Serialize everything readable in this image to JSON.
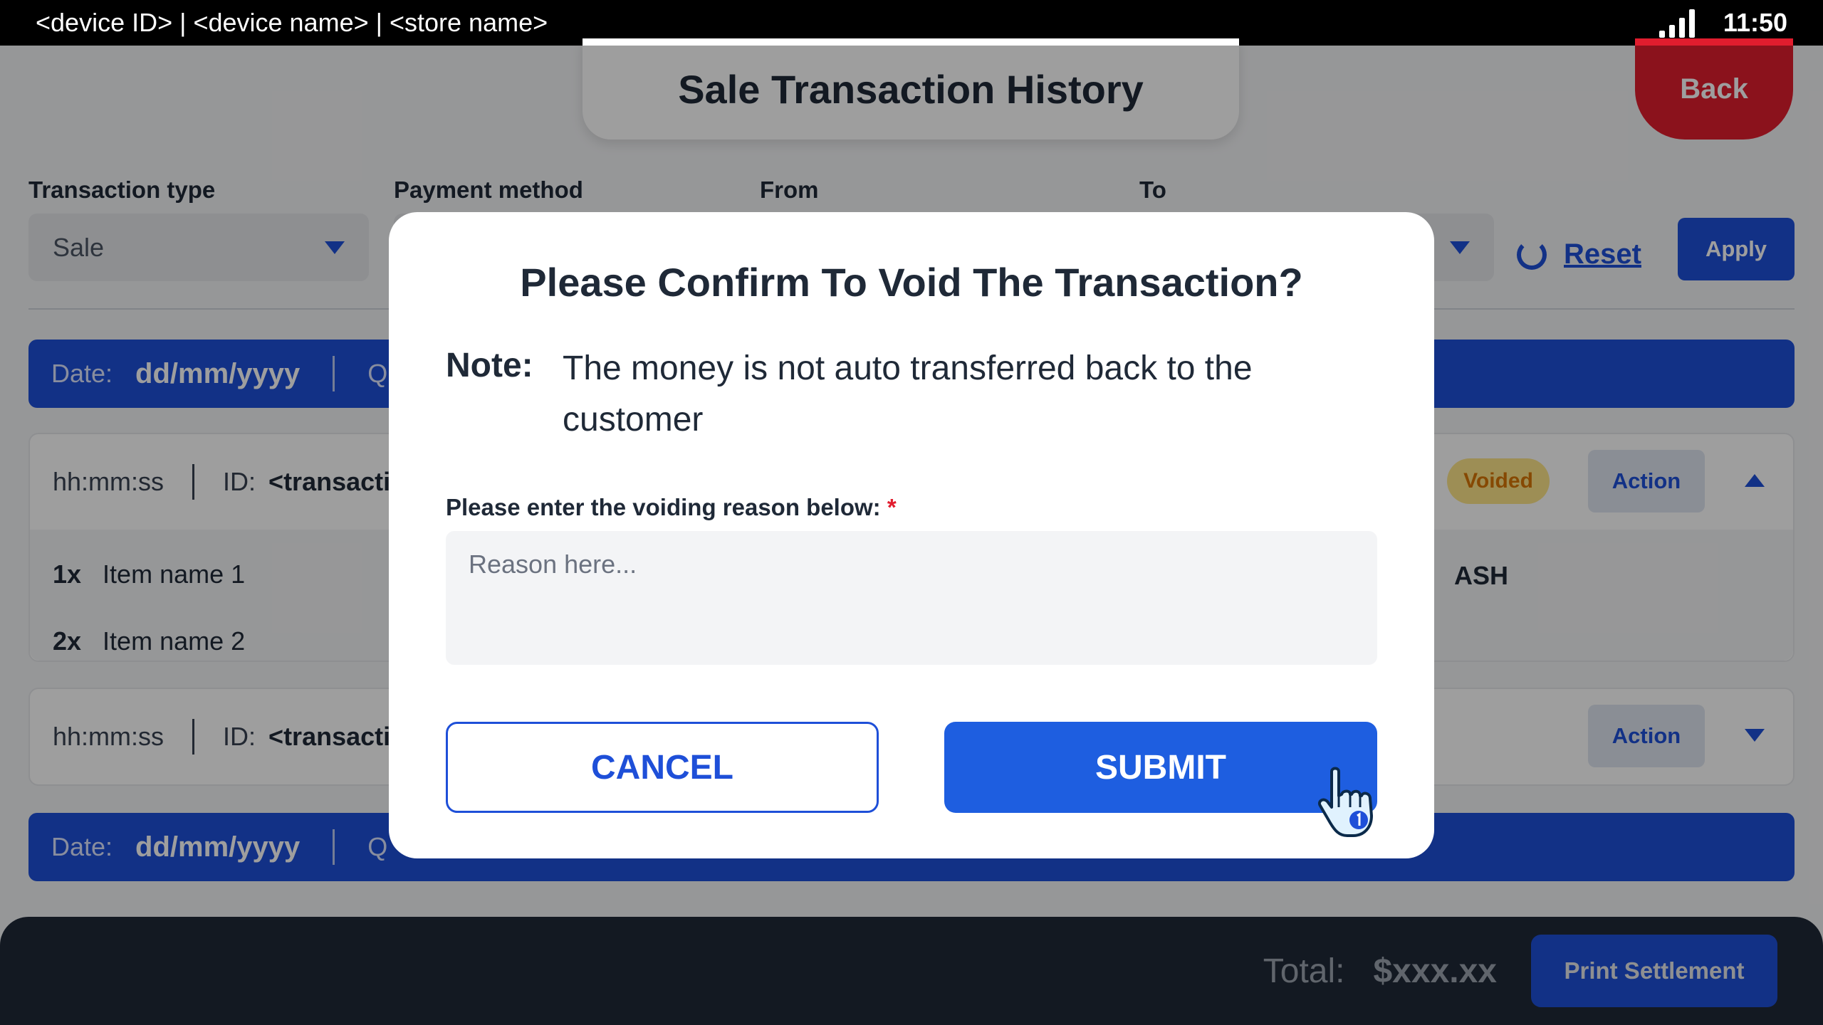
{
  "status_bar": {
    "device_info": "<device ID> | <device name> | <store name>",
    "time": "11:50",
    "icons": [
      "signal-icon"
    ]
  },
  "header": {
    "title": "Sale Transaction History",
    "back_label": "Back"
  },
  "filters": {
    "transaction_type_label": "Transaction type",
    "transaction_type_value": "Sale",
    "payment_method_label": "Payment method",
    "from_label": "From",
    "to_label": "To",
    "reset_label": "Reset",
    "apply_label": "Apply"
  },
  "date_groups": [
    {
      "date_label": "Date:",
      "date_value": "dd/mm/yyyy",
      "partial_text": "Q"
    },
    {
      "date_label": "Date:",
      "date_value": "dd/mm/yyyy",
      "partial_text": "Q"
    }
  ],
  "transactions": [
    {
      "time": "hh:mm:ss",
      "id_label": "ID:",
      "id_value": "<transacti",
      "status": "Voided",
      "action_label": "Action",
      "expanded": true,
      "items": [
        {
          "qty": "1x",
          "name": "Item name 1"
        },
        {
          "qty": "2x",
          "name": "Item name 2"
        }
      ],
      "method_partial": "ASH"
    },
    {
      "time": "hh:mm:ss",
      "id_label": "ID:",
      "id_value": "<transacti",
      "action_label": "Action",
      "expanded": false
    }
  ],
  "footer": {
    "total_label": "Total:",
    "total_value": "$xxx.xx",
    "print_label": "Print Settlement"
  },
  "modal": {
    "title": "Please Confirm To Void The Transaction?",
    "note_label": "Note:",
    "note_text": "The money is not auto transferred back to the customer",
    "reason_label": "Please enter the voiding reason below:",
    "required_mark": "*",
    "reason_placeholder": "Reason here...",
    "reason_value": "",
    "cancel_label": "CANCEL",
    "submit_label": "SUBMIT"
  },
  "colors": {
    "primary": "#1e4fd8",
    "danger": "#e11d2e",
    "voided_badge_bg": "#fde68a",
    "voided_badge_text": "#d97706",
    "footer_bg": "#1f2937"
  }
}
